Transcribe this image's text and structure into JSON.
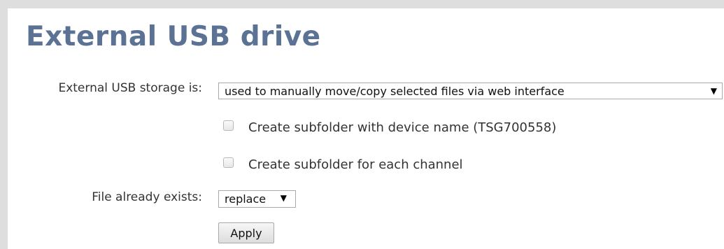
{
  "page": {
    "title": "External USB drive"
  },
  "form": {
    "storage_label": "External USB storage is:",
    "storage_select": {
      "value": "used to manually move/copy selected files via web interface",
      "arrow": "▼"
    },
    "checkboxes": [
      {
        "label": "Create subfolder with device name (TSG700558)",
        "checked": false
      },
      {
        "label": "Create subfolder for each channel",
        "checked": false
      }
    ],
    "exists_label": "File already exists:",
    "exists_select": {
      "value": "replace",
      "arrow": "▼"
    },
    "apply_label": "Apply"
  },
  "colors": {
    "title": "#5b7294",
    "frame": "#dedede",
    "text": "#333333"
  }
}
